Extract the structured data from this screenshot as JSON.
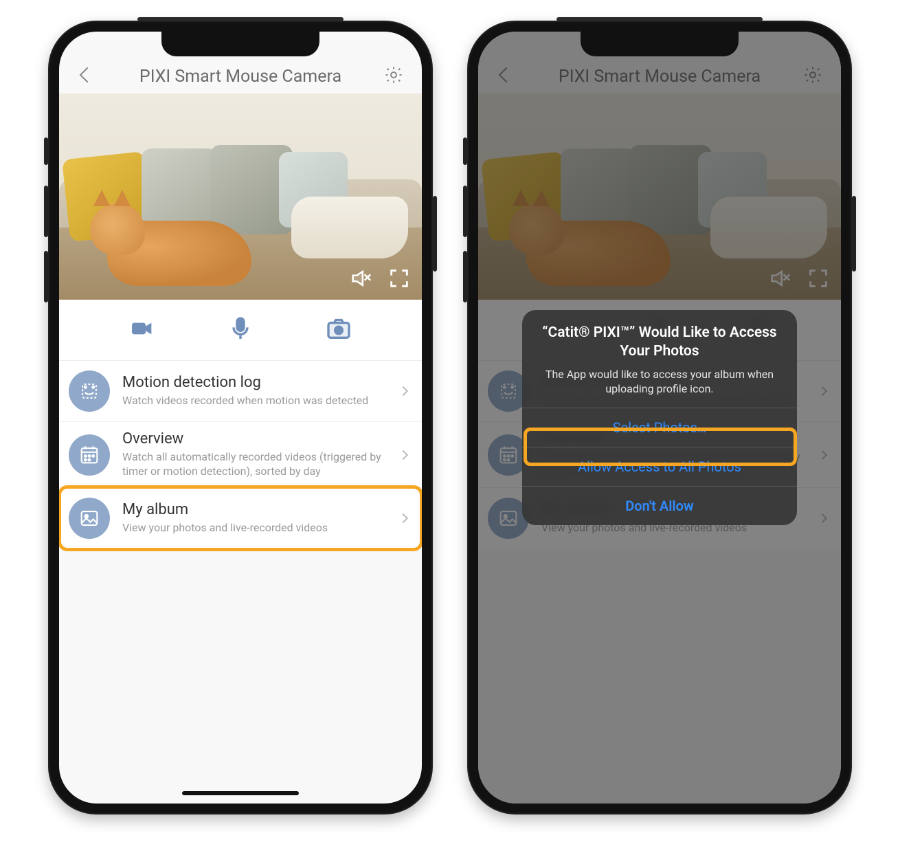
{
  "colors": {
    "accent": "#90a8c9",
    "highlight": "#f5a623",
    "ios_blue": "#2f8bff"
  },
  "header": {
    "title": "PIXI Smart Mouse Camera",
    "back_icon": "chevron-left",
    "settings_icon": "gear"
  },
  "hero": {
    "mute_icon": "speaker-muted",
    "fullscreen_icon": "fullscreen"
  },
  "action_row": {
    "video_icon": "video-camera",
    "mic_icon": "microphone",
    "photo_icon": "camera"
  },
  "menu": [
    {
      "id": "motion-log",
      "icon": "motion-detection",
      "title": "Motion detection log",
      "subtitle": "Watch videos recorded when motion was detected"
    },
    {
      "id": "overview",
      "icon": "calendar-grid",
      "title": "Overview",
      "subtitle": "Watch all automatically recorded videos (triggered by timer or motion detection), sorted by day"
    },
    {
      "id": "my-album",
      "icon": "photo-album",
      "title": "My album",
      "subtitle": "View your photos and live-recorded videos"
    }
  ],
  "permission_dialog": {
    "title": "“Catit® PIXI™” Would Like to Access Your Photos",
    "message": "The App would like to access your album when uploading profile icon.",
    "option_select": "Select Photos…",
    "option_allow_all": "Allow Access to All Photos",
    "option_deny": "Don't Allow"
  }
}
